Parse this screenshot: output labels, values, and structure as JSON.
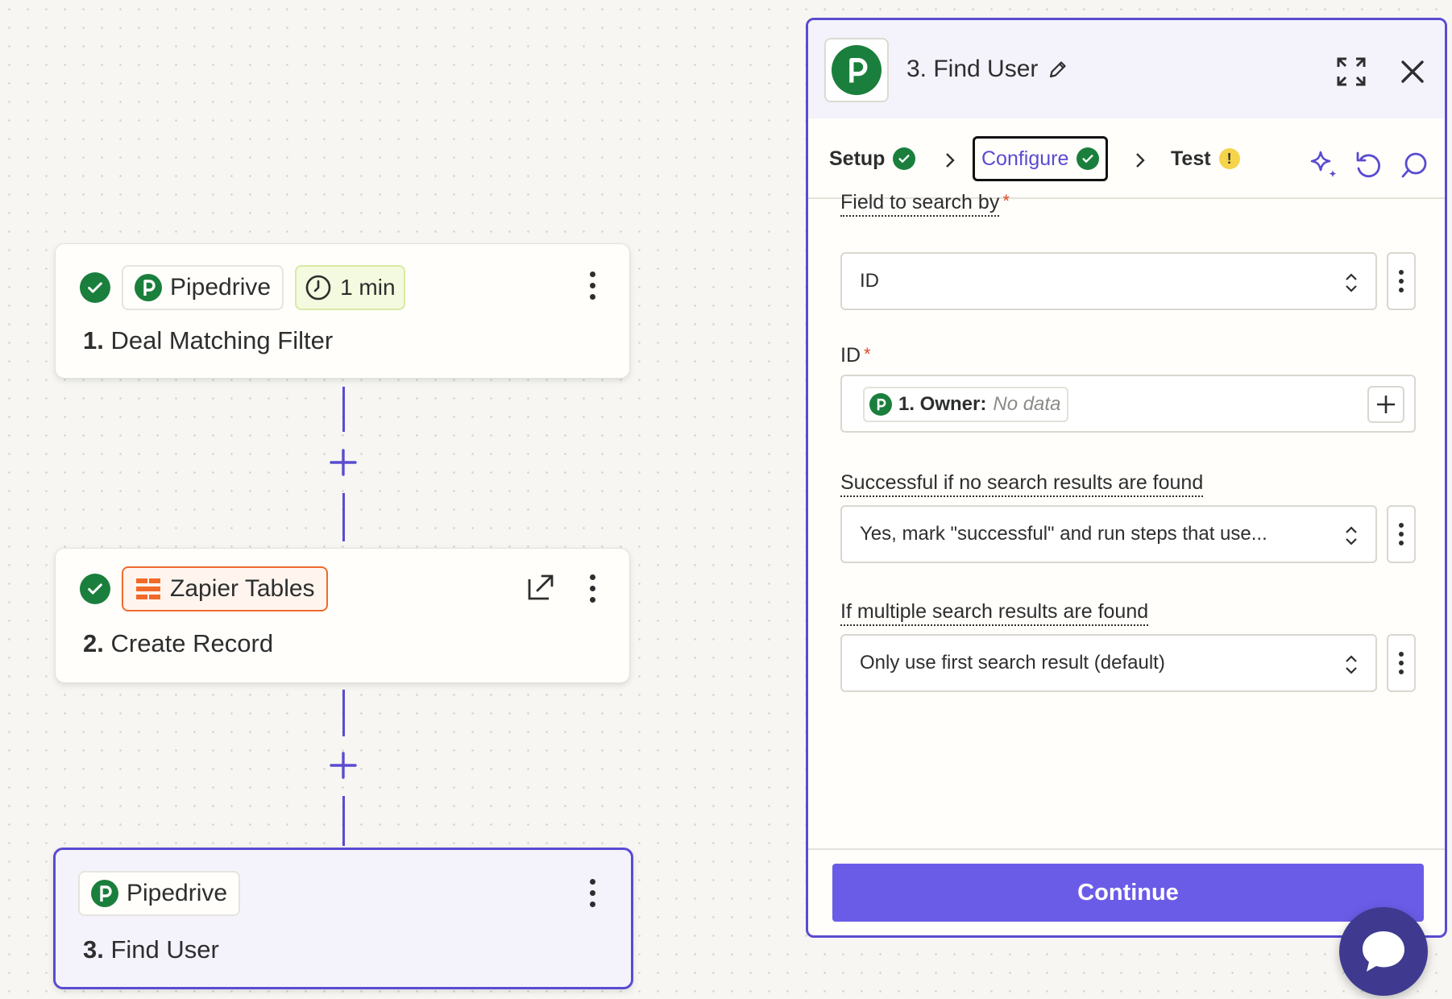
{
  "canvas": {
    "steps": [
      {
        "app": "Pipedrive",
        "time_badge": "1 min",
        "number": "1.",
        "title": "Deal Matching Filter",
        "status": "complete"
      },
      {
        "app": "Zapier Tables",
        "number": "2.",
        "title": "Create Record",
        "status": "complete"
      },
      {
        "app": "Pipedrive",
        "number": "3.",
        "title": "Find User",
        "status": "selected"
      }
    ]
  },
  "panel": {
    "title": "3. Find User",
    "tabs": [
      {
        "label": "Setup",
        "state": "complete"
      },
      {
        "label": "Configure",
        "state": "active-complete"
      },
      {
        "label": "Test",
        "state": "warning"
      }
    ],
    "test_warning_glyph": "!",
    "fields": {
      "search_by": {
        "label": "Field to search by",
        "required": "*",
        "value": "ID"
      },
      "id": {
        "label": "ID",
        "required": "*",
        "pill_label": "1. Owner:",
        "pill_value": "No data"
      },
      "no_results": {
        "label": "Successful if no search results are found",
        "value": "Yes, mark \"successful\" and run steps that use..."
      },
      "multiple": {
        "label": "If multiple search results are found",
        "value": "Only use first search result (default)"
      }
    },
    "continue_label": "Continue"
  },
  "colors": {
    "accent": "#5a4bd1",
    "button": "#6b5ce7",
    "success": "#1a7f3c",
    "warning": "#f5d34a",
    "zapier_orange": "#f06a2a"
  }
}
